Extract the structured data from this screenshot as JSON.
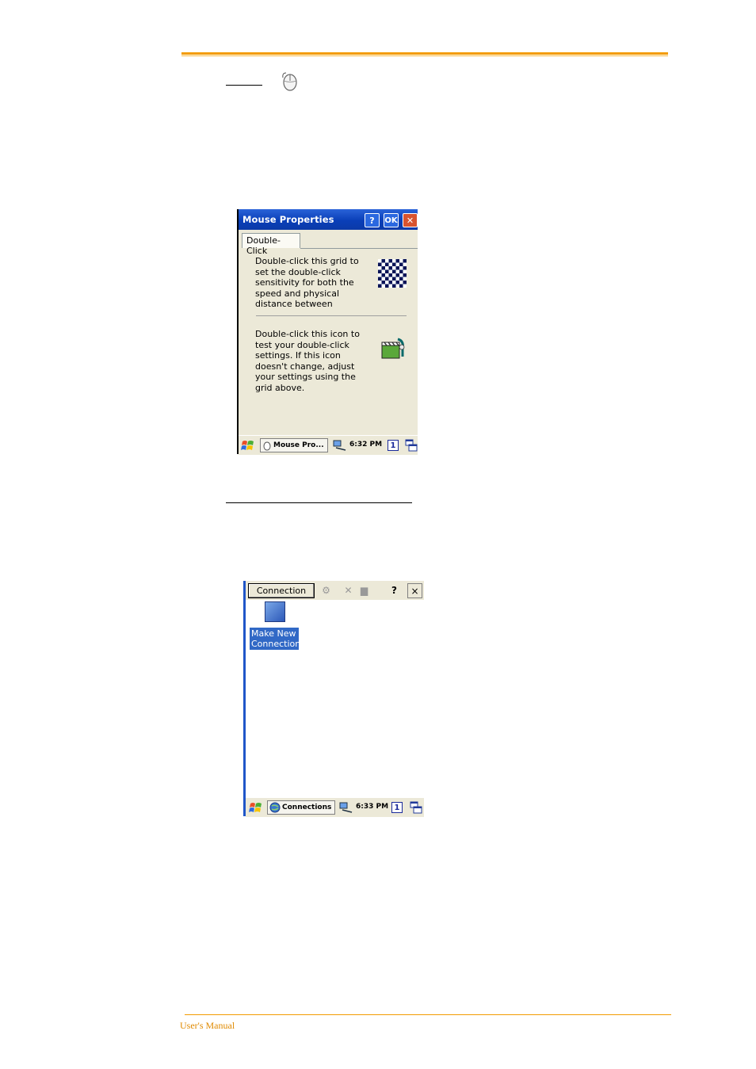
{
  "footer": {
    "text": "User's Manual"
  },
  "mouse_properties": {
    "title": "Mouse Properties",
    "help_label": "?",
    "ok_label": "OK",
    "close_label": "✕",
    "tab": "Double-Click",
    "text1_lines": [
      "Double-click this grid to",
      "set the double-click",
      "sensitivity for both the",
      "speed and physical",
      "distance between"
    ],
    "text2_lines": [
      "Double-click this icon to",
      "test your double-click",
      "settings. If this icon",
      "doesn't change, adjust",
      "your settings using the",
      "grid above."
    ],
    "taskbar": {
      "app": "Mouse Pro...",
      "time": "6:32 PM",
      "desktop": "1"
    }
  },
  "connections": {
    "menu_button": "Connection",
    "help_label": "?",
    "close_label": "×",
    "item_lines": [
      "Make New",
      "Connection"
    ],
    "taskbar": {
      "app": "Connections",
      "time": "6:33 PM",
      "desktop": "1"
    }
  }
}
